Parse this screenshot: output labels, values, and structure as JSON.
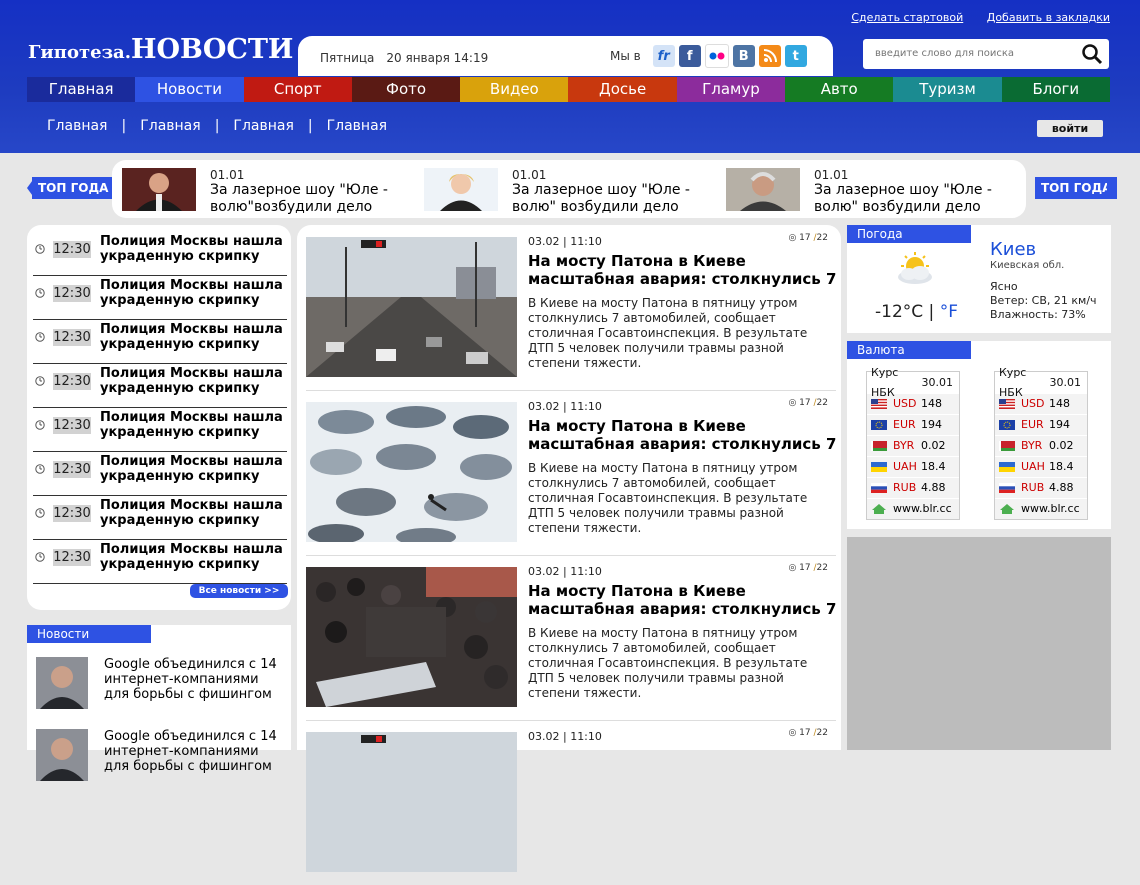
{
  "header": {
    "links": [
      "Сделать стартовой",
      "Добавить в закладки"
    ],
    "logo_part1": "Гипотеза.",
    "logo_part2": "НОВОСТИ",
    "day": "Пятница",
    "date": "20 января 14:19",
    "social_label": "Мы в",
    "socials": [
      {
        "glyph": "fr",
        "color": "#d4e3f7",
        "icon": "friendfeed-icon"
      },
      {
        "glyph": "f",
        "color": "#3b5b9b",
        "icon": "facebook-icon"
      },
      {
        "glyph": "••",
        "color": "#ffffff",
        "icon": "flickr-icon"
      },
      {
        "glyph": "B",
        "color": "#4d74a4",
        "icon": "vkontakte-icon"
      },
      {
        "glyph": "))",
        "color": "#f48a18",
        "icon": "rss-icon"
      },
      {
        "glyph": "t",
        "color": "#31a8e0",
        "icon": "twitter-icon"
      }
    ],
    "search_placeholder": "введите слово для поиска",
    "login": "войти"
  },
  "nav": [
    {
      "label": "Главная",
      "color": "#1a2b9c"
    },
    {
      "label": "Новости",
      "color": "#2e52e3"
    },
    {
      "label": "Спорт",
      "color": "#c01a12"
    },
    {
      "label": "Фото",
      "color": "#5a1a14"
    },
    {
      "label": "Видео",
      "color": "#d9a20c"
    },
    {
      "label": "Досье",
      "color": "#c8380e"
    },
    {
      "label": "Гламур",
      "color": "#8c2c9c"
    },
    {
      "label": "Авто",
      "color": "#157b23"
    },
    {
      "label": "Туризм",
      "color": "#1b8b91"
    },
    {
      "label": "Блоги",
      "color": "#0a6b33"
    }
  ],
  "subnav": [
    "Главная",
    "Главная",
    "Главная",
    "Главная"
  ],
  "top": {
    "label": "ТОП ГОДА",
    "items": [
      {
        "date": "01.01",
        "title": "За лазерное шоу \"Юле - волю\"возбудили дело"
      },
      {
        "date": "01.01",
        "title": "За лазерное шоу \"Юле - волю\" возбудили дело"
      },
      {
        "date": "01.01",
        "title": "За лазерное шоу \"Юле - волю\" возбудили дело"
      }
    ]
  },
  "latest": {
    "items": [
      {
        "time": "12:30",
        "title": "Полиция Москвы нашла украденную скрипку"
      },
      {
        "time": "12:30",
        "title": "Полиция Москвы нашла украденную скрипку"
      },
      {
        "time": "12:30",
        "title": "Полиция Москвы нашла украденную скрипку"
      },
      {
        "time": "12:30",
        "title": "Полиция Москвы нашла украденную скрипку"
      },
      {
        "time": "12:30",
        "title": "Полиция Москвы нашла украденную скрипку"
      },
      {
        "time": "12:30",
        "title": "Полиция Москвы нашла украденную скрипку"
      },
      {
        "time": "12:30",
        "title": "Полиция Москвы нашла украденную скрипку"
      },
      {
        "time": "12:30",
        "title": "Полиция Москвы нашла украденную скрипку"
      }
    ],
    "all_label": "Все новости >>"
  },
  "news_box": {
    "title": "Новости",
    "items": [
      {
        "title": "Google объединился с 14 интернет-компаниями для борьбы с фишингом"
      },
      {
        "title": "Google объединился с 14 интернет-компаниями для борьбы с фишингом"
      }
    ]
  },
  "articles": [
    {
      "meta": "03.02 | 11:10",
      "views": "17",
      "comments": "22",
      "title": "На мосту Патона в Киеве масштабная авария: столкнулись 7",
      "text": "В Киеве на мосту Патона в пятницу утром столкнулись 7 автомобилей, сообщает столичная Госавтоинспекция. В результате ДТП 5 человек получили травмы разной степени тяжести."
    },
    {
      "meta": "03.02 | 11:10",
      "views": "17",
      "comments": "22",
      "title": "На мосту Патона в Киеве масштабная авария: столкнулись 7",
      "text": "В Киеве на мосту Патона в пятницу утром столкнулись 7 автомобилей, сообщает столичная Госавтоинспекция. В результате ДТП 5 человек получили травмы разной степени тяжести."
    },
    {
      "meta": "03.02 | 11:10",
      "views": "17",
      "comments": "22",
      "title": "На мосту Патона в Киеве масштабная авария: столкнулись 7",
      "text": "В Киеве на мосту Патона в пятницу утром столкнулись 7 автомобилей, сообщает столичная Госавтоинспекция. В результате ДТП 5 человек получили травмы разной степени тяжести."
    },
    {
      "meta": "03.02 | 11:10",
      "views": "17",
      "comments": "22",
      "title": "",
      "text": ""
    }
  ],
  "weather": {
    "title": "Погода",
    "temp": "-12°C |",
    "unit": "°F",
    "city": "Киев",
    "region": "Киевская обл.",
    "condition": "Ясно",
    "wind": "Ветер: СВ, 21 км/ч",
    "humidity": "Влажность: 73%"
  },
  "currency": {
    "title": "Валюта",
    "head_label": "Курс НБК",
    "head_value": "30.01",
    "rows": [
      {
        "code": "USD",
        "value": "148"
      },
      {
        "code": "EUR",
        "value": "194"
      },
      {
        "code": "BYR",
        "value": "0.02"
      },
      {
        "code": "UAH",
        "value": "18.4"
      },
      {
        "code": "RUB",
        "value": "4.88"
      }
    ],
    "site": "www.blr.cc"
  }
}
